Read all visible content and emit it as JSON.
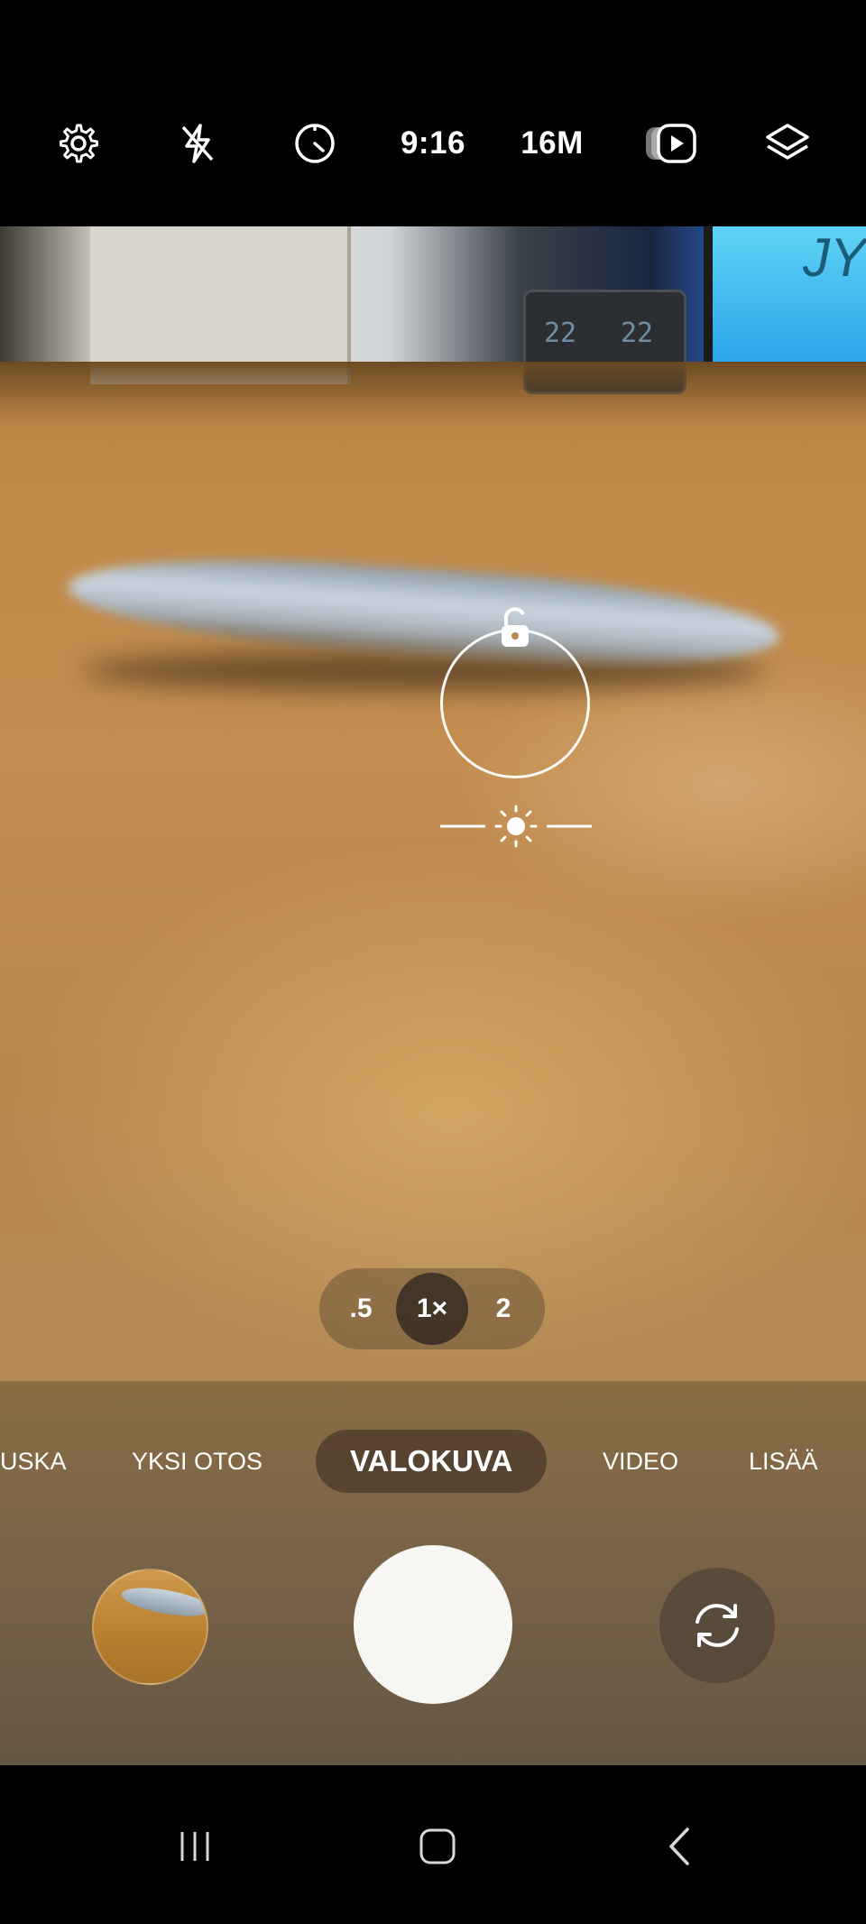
{
  "top_bar": {
    "settings_icon": "gear-icon",
    "flash_icon": "flash-off-icon",
    "timer_icon": "timer-icon",
    "aspect_ratio": "9:16",
    "resolution": "16M",
    "motion_photo_icon": "motion-photo-icon",
    "filters_icon": "layers-icon"
  },
  "zoom": {
    "options": [
      ".5",
      "1×",
      "2"
    ],
    "selected": "1×"
  },
  "modes": {
    "items": [
      "USKA",
      "YKSI OTOS",
      "VALOKUVA",
      "VIDEO",
      "LISÄÄ"
    ],
    "selected": "VALOKUVA"
  },
  "scene": {
    "clock_left": "22",
    "clock_right": "22",
    "screen_text": "JY"
  },
  "controls": {
    "gallery_thumbnail": "gallery-thumbnail",
    "shutter": "shutter-button",
    "switch_camera_icon": "switch-camera-icon"
  },
  "nav": {
    "recents_icon": "recents-icon",
    "home_icon": "home-icon",
    "back_icon": "back-icon"
  }
}
